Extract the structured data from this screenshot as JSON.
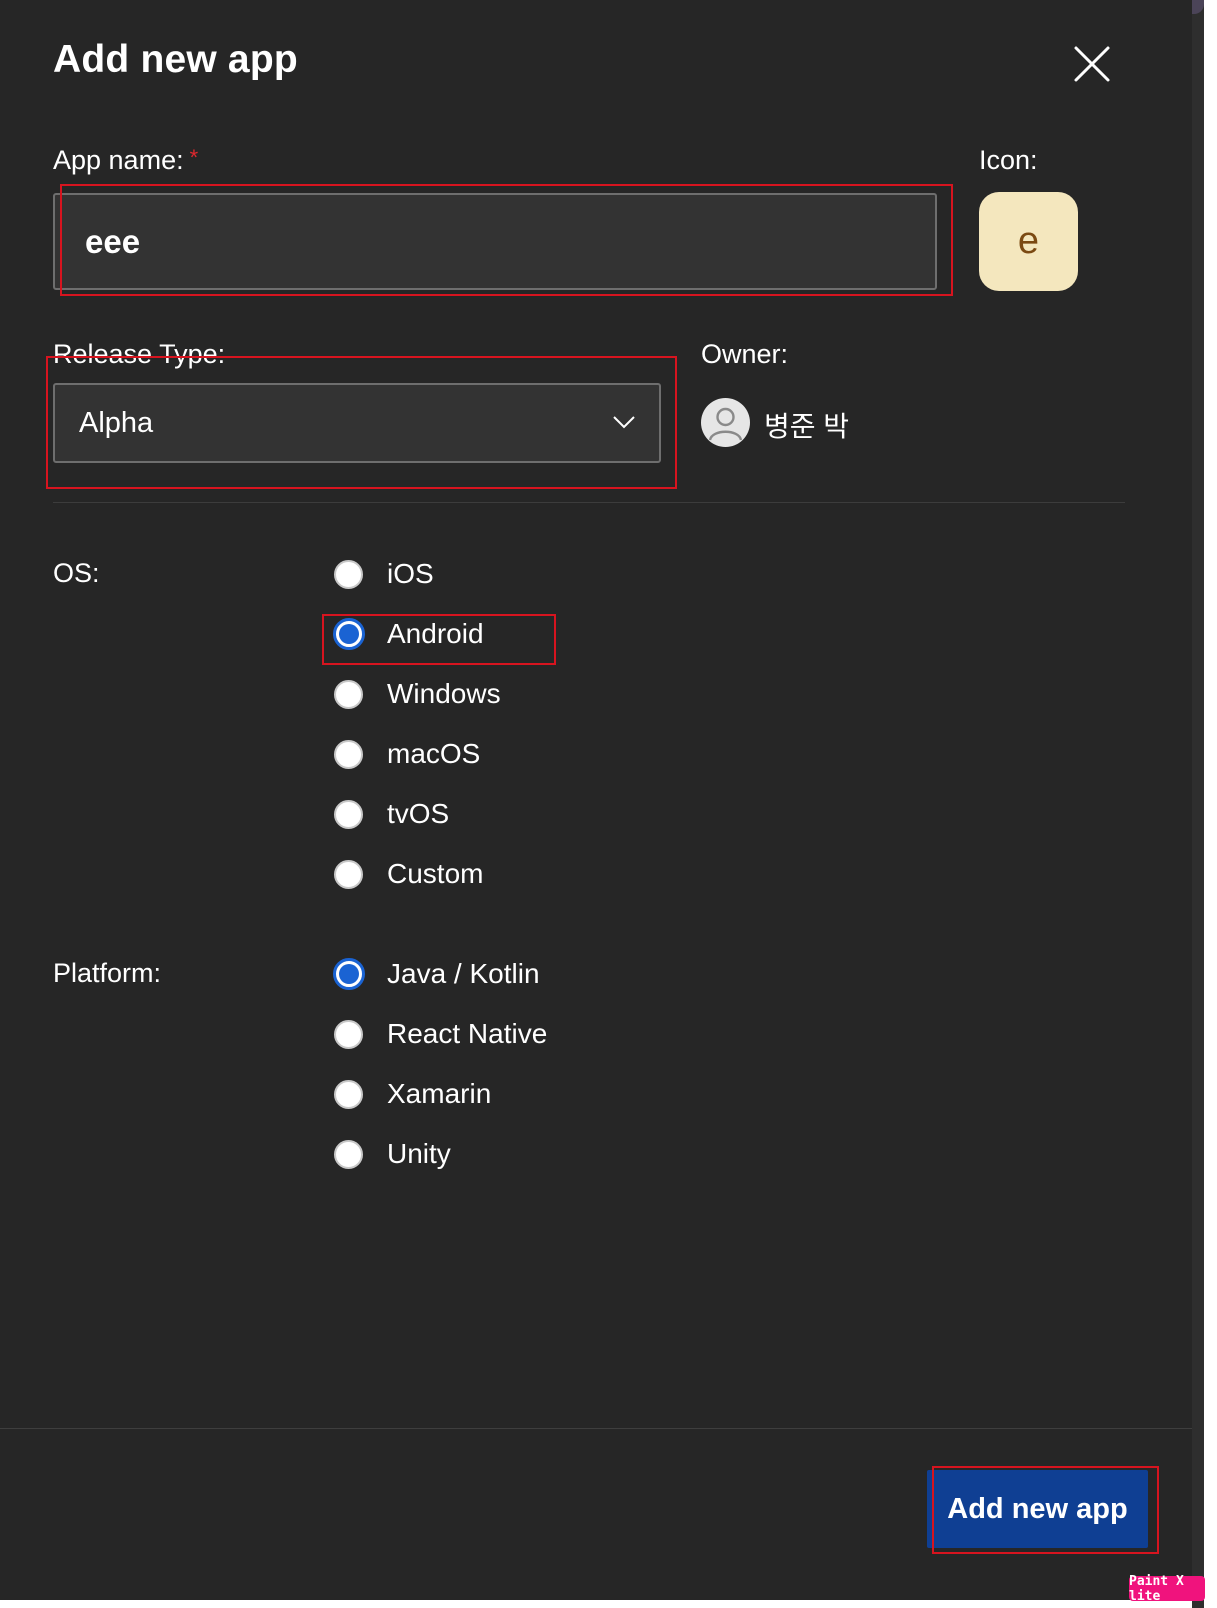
{
  "dialog": {
    "title": "Add new app",
    "close_icon": "close-icon"
  },
  "app_name": {
    "label": "App name:",
    "required_mark": "*",
    "value": "eee"
  },
  "icon": {
    "label": "Icon:",
    "letter": "e",
    "background_color": "#f4e7be"
  },
  "release_type": {
    "label": "Release Type:",
    "value": "Alpha",
    "chevron_icon": "chevron-down-icon"
  },
  "owner": {
    "label": "Owner:",
    "name": "병준 박",
    "avatar_icon": "user-avatar-icon"
  },
  "os": {
    "label": "OS:",
    "options": [
      {
        "label": "iOS",
        "selected": false
      },
      {
        "label": "Android",
        "selected": true
      },
      {
        "label": "Windows",
        "selected": false
      },
      {
        "label": "macOS",
        "selected": false
      },
      {
        "label": "tvOS",
        "selected": false
      },
      {
        "label": "Custom",
        "selected": false
      }
    ]
  },
  "platform": {
    "label": "Platform:",
    "options": [
      {
        "label": "Java / Kotlin",
        "selected": true
      },
      {
        "label": "React Native",
        "selected": false
      },
      {
        "label": "Xamarin",
        "selected": false
      },
      {
        "label": "Unity",
        "selected": false
      }
    ]
  },
  "footer": {
    "submit_label": "Add new app"
  },
  "watermark": {
    "text": "Paint X lite"
  },
  "colors": {
    "background": "#262626",
    "accent": "#1a63d3",
    "button": "#0f3f93",
    "annotation": "#d7141f",
    "required": "#e0282e"
  }
}
